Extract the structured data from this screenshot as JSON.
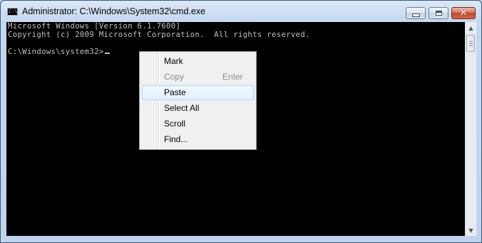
{
  "window": {
    "title": "Administrator: C:\\Windows\\System32\\cmd.exe",
    "app_icon": "console-icon",
    "app_icon_text": "C:\\",
    "controls": [
      "minimize-icon",
      "maximize-icon",
      "close-icon"
    ],
    "close_glyph": "✕"
  },
  "console": {
    "lines": [
      "Microsoft Windows [Version 6.1.7600]",
      "Copyright (c) 2009 Microsoft Corporation.  All rights reserved.",
      "C:\\Windows\\system32>"
    ],
    "text_color": "#c0c0c0",
    "background": "#000000"
  },
  "scrollbar": {
    "up_arrow": "▲",
    "down_arrow": "▼"
  },
  "context_menu": {
    "items": [
      {
        "label": "Mark",
        "shortcut": "",
        "enabled": true
      },
      {
        "label": "Copy",
        "shortcut": "Enter",
        "enabled": false
      },
      {
        "label": "Paste",
        "shortcut": "",
        "enabled": true,
        "highlighted": true
      },
      {
        "label": "Select All",
        "shortcut": "",
        "enabled": true
      },
      {
        "label": "Scroll",
        "shortcut": "",
        "enabled": true
      },
      {
        "label": "Find...",
        "shortcut": "",
        "enabled": true
      }
    ]
  }
}
